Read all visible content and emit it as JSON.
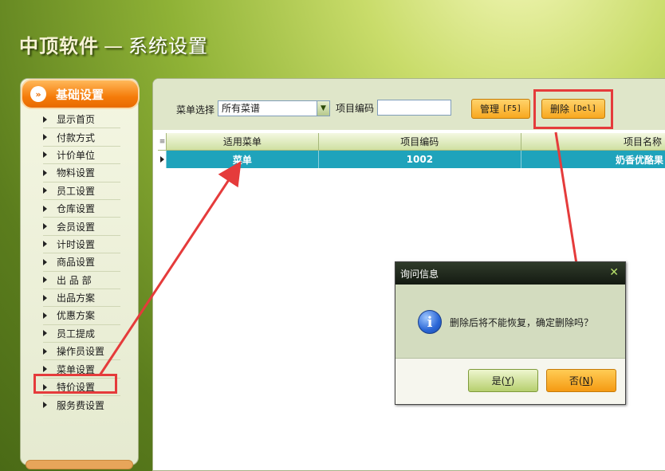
{
  "header": {
    "brand": "中顶软件",
    "separator": "—",
    "subtitle": "系统设置"
  },
  "sidebar": {
    "header_label": "基础设置",
    "header_icon": "double-chevron-right-icon",
    "items": [
      {
        "label": "显示首页"
      },
      {
        "label": "付款方式"
      },
      {
        "label": "计价单位"
      },
      {
        "label": "物料设置"
      },
      {
        "label": "员工设置"
      },
      {
        "label": "仓库设置"
      },
      {
        "label": "会员设置"
      },
      {
        "label": "计时设置"
      },
      {
        "label": "商品设置"
      },
      {
        "label": "出 品 部"
      },
      {
        "label": "出品方案"
      },
      {
        "label": "优惠方案"
      },
      {
        "label": "员工提成"
      },
      {
        "label": "操作员设置"
      },
      {
        "label": "菜单设置"
      },
      {
        "label": "特价设置"
      },
      {
        "label": "服务费设置"
      }
    ]
  },
  "toolbar": {
    "menu_select_label": "菜单选择",
    "menu_select_value": "所有菜谱",
    "item_code_label": "项目编码",
    "item_code_value": "",
    "manage_label": "管理",
    "manage_key": "[F5]",
    "delete_label": "删除",
    "delete_key": "[Del]"
  },
  "grid": {
    "columns": [
      "适用菜单",
      "项目编码",
      "项目名称"
    ],
    "rows": [
      {
        "menu": "菜单",
        "code": "1002",
        "name": "奶香优酪果"
      }
    ]
  },
  "dialog": {
    "title": "询问信息",
    "close_glyph": "✕",
    "message": "删除后将不能恢复，确定删除吗？",
    "yes_label": "是(",
    "yes_key": "Y",
    "no_label": "否(",
    "no_key": "N",
    "paren_close": ")"
  },
  "colors": {
    "accent_orange": "#f57c0a",
    "row_selected": "#1fa3bb",
    "annotation_red": "#e53b3b"
  }
}
